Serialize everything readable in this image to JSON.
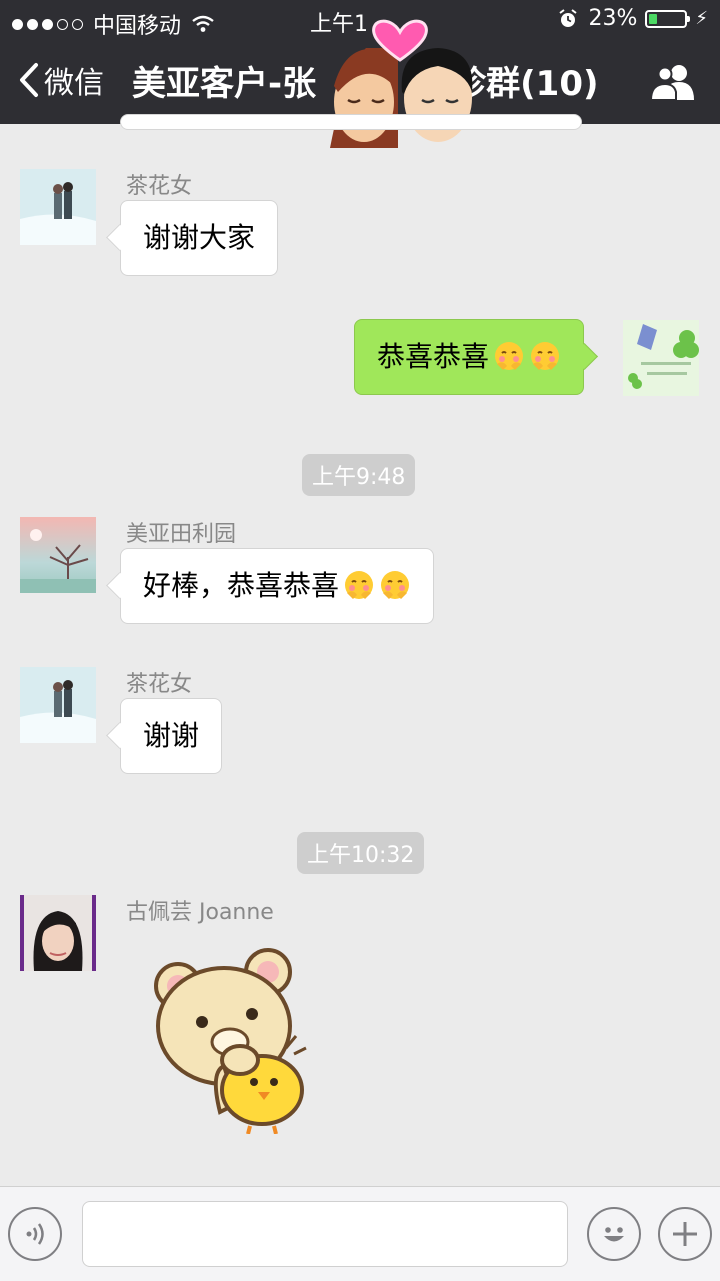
{
  "status": {
    "carrier": "中国移动",
    "time": "上午1",
    "battery": "23%",
    "battery_level": 0.23
  },
  "nav": {
    "back_label": "微信",
    "title_left": "美亚客户-张",
    "title_right": "珍群(10)"
  },
  "messages": [
    {
      "sender": "茶花女",
      "text": "谢谢大家"
    },
    {
      "self": true,
      "text": "恭喜恭喜"
    },
    {
      "time": "上午9:48"
    },
    {
      "sender": "美亚田利园",
      "text": "好棒，恭喜恭喜"
    },
    {
      "sender": "茶花女",
      "text": "谢谢"
    },
    {
      "time": "上午10:32"
    },
    {
      "sender": "古佩芸 Joanne",
      "sticker": "bear-chick-sticker"
    }
  ],
  "icons": {
    "back": "chevron-left-icon",
    "group": "people-icon",
    "voice": "voice-icon",
    "emoji": "smiley-icon",
    "more": "plus-icon"
  },
  "colors": {
    "navbar": "#2e2e33",
    "background": "#ebebeb",
    "self_bubble": "#a0e75a",
    "battery": "#4cd964"
  }
}
